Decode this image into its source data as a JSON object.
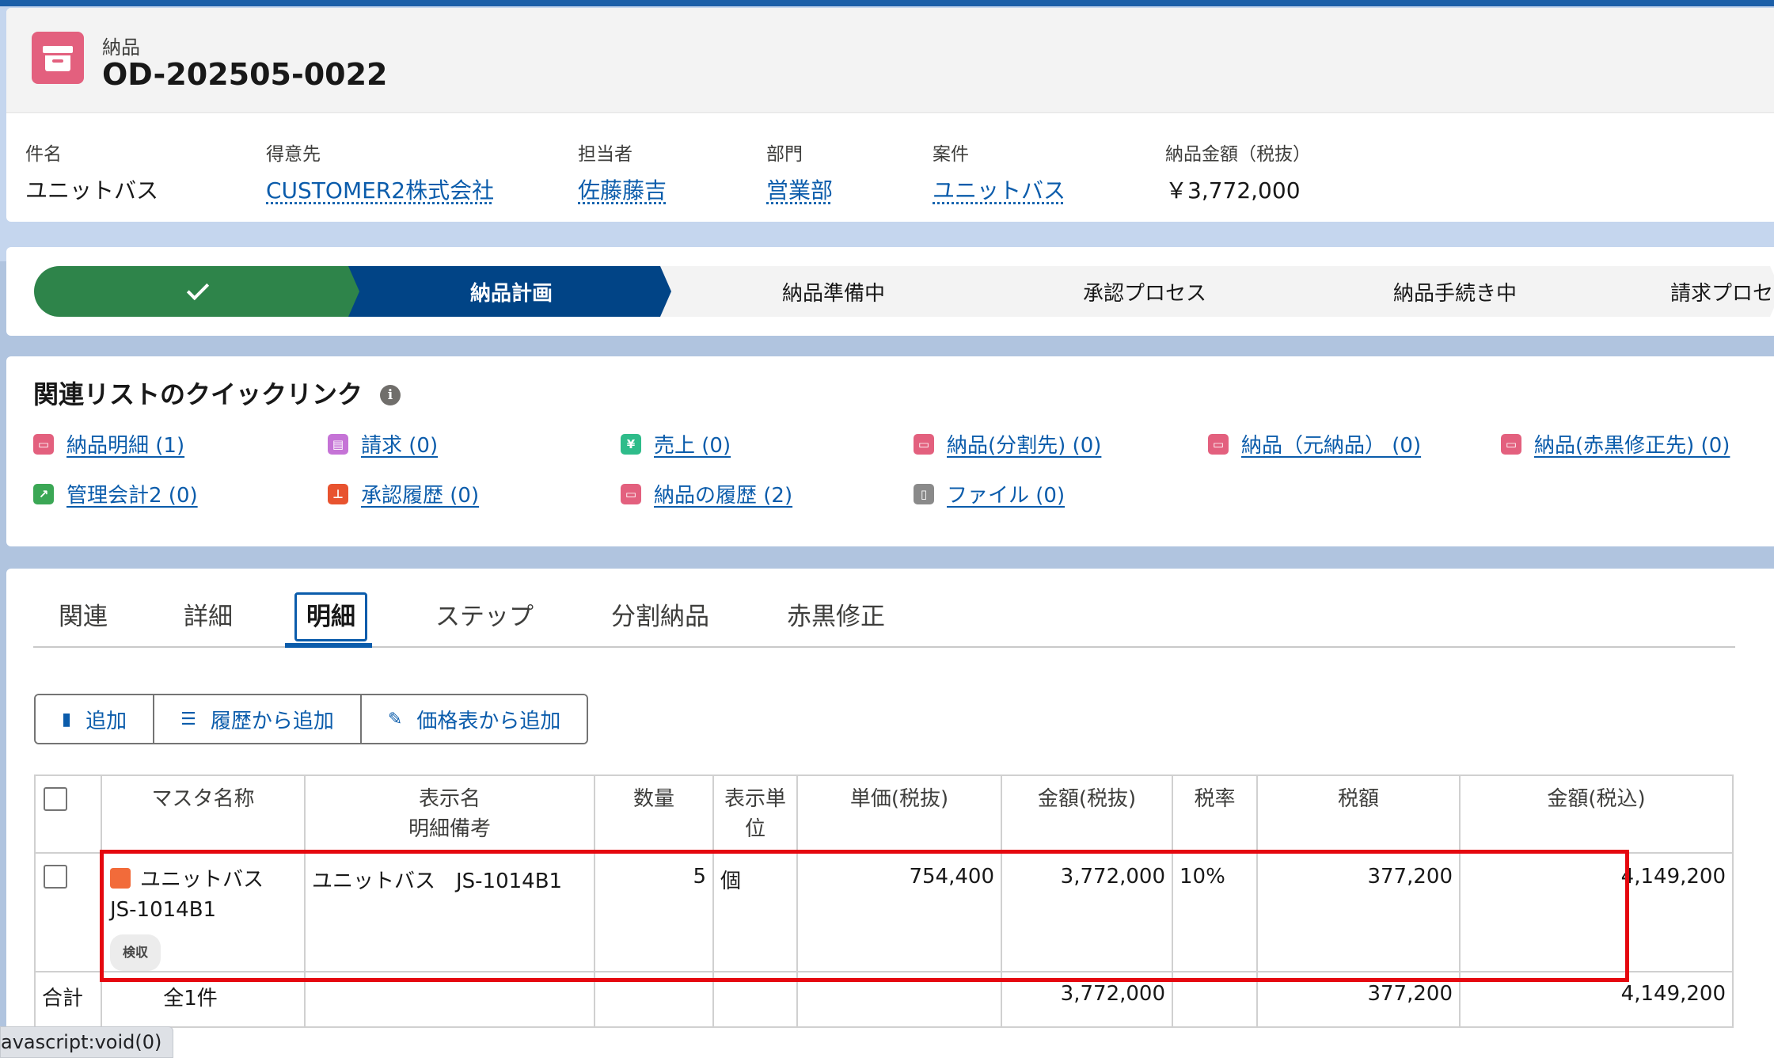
{
  "header": {
    "object_label": "納品",
    "record_title": "OD-202505-0022",
    "fields": [
      {
        "label": "件名",
        "value": "ユニットバス"
      },
      {
        "label": "得意先",
        "value": "CUSTOMER2株式会社"
      },
      {
        "label": "担当者",
        "value": "佐藤藤吉"
      },
      {
        "label": "部門",
        "value": "営業部"
      },
      {
        "label": "案件",
        "value": "ユニットバス"
      },
      {
        "label": "納品金額（税抜）",
        "value": "￥3,772,000"
      }
    ]
  },
  "path": {
    "steps": [
      {
        "label": "",
        "state": "done"
      },
      {
        "label": "納品計画",
        "state": "current"
      },
      {
        "label": "納品準備中",
        "state": "todo"
      },
      {
        "label": "承認プロセス",
        "state": "todo"
      },
      {
        "label": "納品手続き中",
        "state": "todo"
      },
      {
        "label": "請求プロセ",
        "state": "todo"
      }
    ]
  },
  "quick_links": {
    "title": "関連リストのクイックリンク",
    "items": [
      {
        "label": "納品明細 (1)",
        "icon": "box-icon",
        "color": "#e3607e"
      },
      {
        "label": "請求 (0)",
        "icon": "invoice-icon",
        "color": "#c573d6"
      },
      {
        "label": "売上 (0)",
        "icon": "yen-icon",
        "color": "#2ebc8a"
      },
      {
        "label": "納品(分割先) (0)",
        "icon": "box-icon",
        "color": "#e3607e"
      },
      {
        "label": "納品（元納品） (0)",
        "icon": "box-icon",
        "color": "#e3607e"
      },
      {
        "label": "納品(赤黒修正先) (0)",
        "icon": "box-icon",
        "color": "#e3607e"
      },
      {
        "label": "管理会計2 (0)",
        "icon": "chart-icon",
        "color": "#3ba755"
      },
      {
        "label": "承認履歴 (0)",
        "icon": "approval-icon",
        "color": "#e8532f"
      },
      {
        "label": "納品の履歴 (2)",
        "icon": "box-icon",
        "color": "#e3607e"
      },
      {
        "label": "ファイル (0)",
        "icon": "file-icon",
        "color": "#8a8a8a"
      }
    ]
  },
  "tabs": [
    "関連",
    "詳細",
    "明細",
    "ステップ",
    "分割納品",
    "赤黒修正"
  ],
  "active_tab": "明細",
  "actions": {
    "add": "追加",
    "add_from_history": "履歴から追加",
    "add_from_pricebook": "価格表から追加"
  },
  "table": {
    "headers": {
      "master_name": "マスタ名称",
      "display_name": "表示名",
      "detail_note": "明細備考",
      "quantity": "数量",
      "unit_line1": "表示単",
      "unit_line2": "位",
      "unit_price": "単価(税抜)",
      "amount_ex": "金額(税抜)",
      "tax_rate": "税率",
      "tax_amount": "税額",
      "amount_in": "金額(税込)"
    },
    "row": {
      "master_name": "ユニットバス",
      "master_code": "JS-1014B1",
      "badge": "検収",
      "display_name": "ユニットバス　JS-1014B1",
      "quantity": "5",
      "unit": "個",
      "unit_price": "754,400",
      "amount_ex": "3,772,000",
      "tax_rate": "10%",
      "tax_amount": "377,200",
      "amount_in": "4,149,200"
    },
    "total": {
      "label": "合計",
      "count": "全1件",
      "amount_ex": "3,772,000",
      "tax_amount": "377,200",
      "amount_in": "4,149,200"
    }
  },
  "status_bar": "avascript:void(0)"
}
